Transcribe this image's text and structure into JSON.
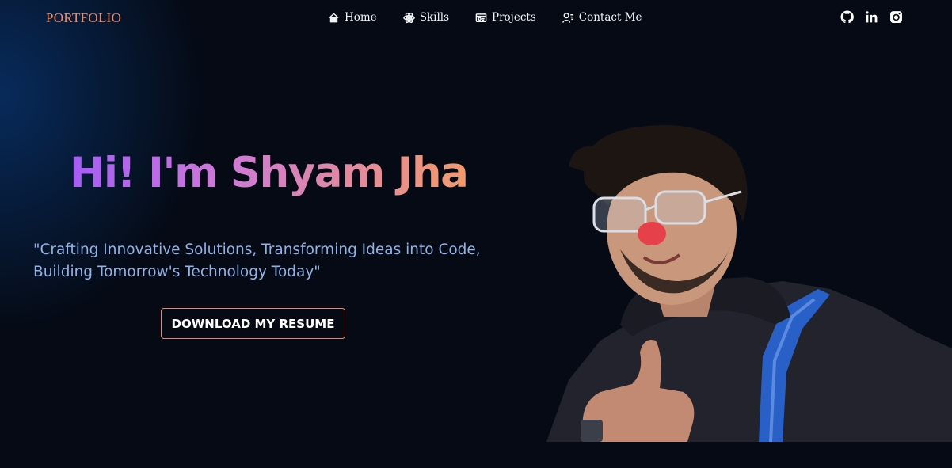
{
  "brand": "PORTFOLIO",
  "nav": [
    {
      "label": "Home",
      "icon": "home-icon"
    },
    {
      "label": "Skills",
      "icon": "atom-icon"
    },
    {
      "label": "Projects",
      "icon": "projects-icon"
    },
    {
      "label": "Contact Me",
      "icon": "contact-icon"
    }
  ],
  "socials": [
    "github-icon",
    "linkedin-icon",
    "instagram-icon"
  ],
  "hero": {
    "title": "Hi! I'm Shyam Jha",
    "tagline": "\"Crafting Innovative Solutions, Transforming Ideas into Code, Building Tomorrow's Technology Today\"",
    "cta": "DOWNLOAD MY RESUME"
  },
  "colors": {
    "background": "#050a14",
    "brand": "#f08a6a",
    "tagline": "#8fb2e8",
    "title_gradient": [
      "#a55cf5",
      "#f29a6c"
    ],
    "button_border": "#e8866a"
  }
}
